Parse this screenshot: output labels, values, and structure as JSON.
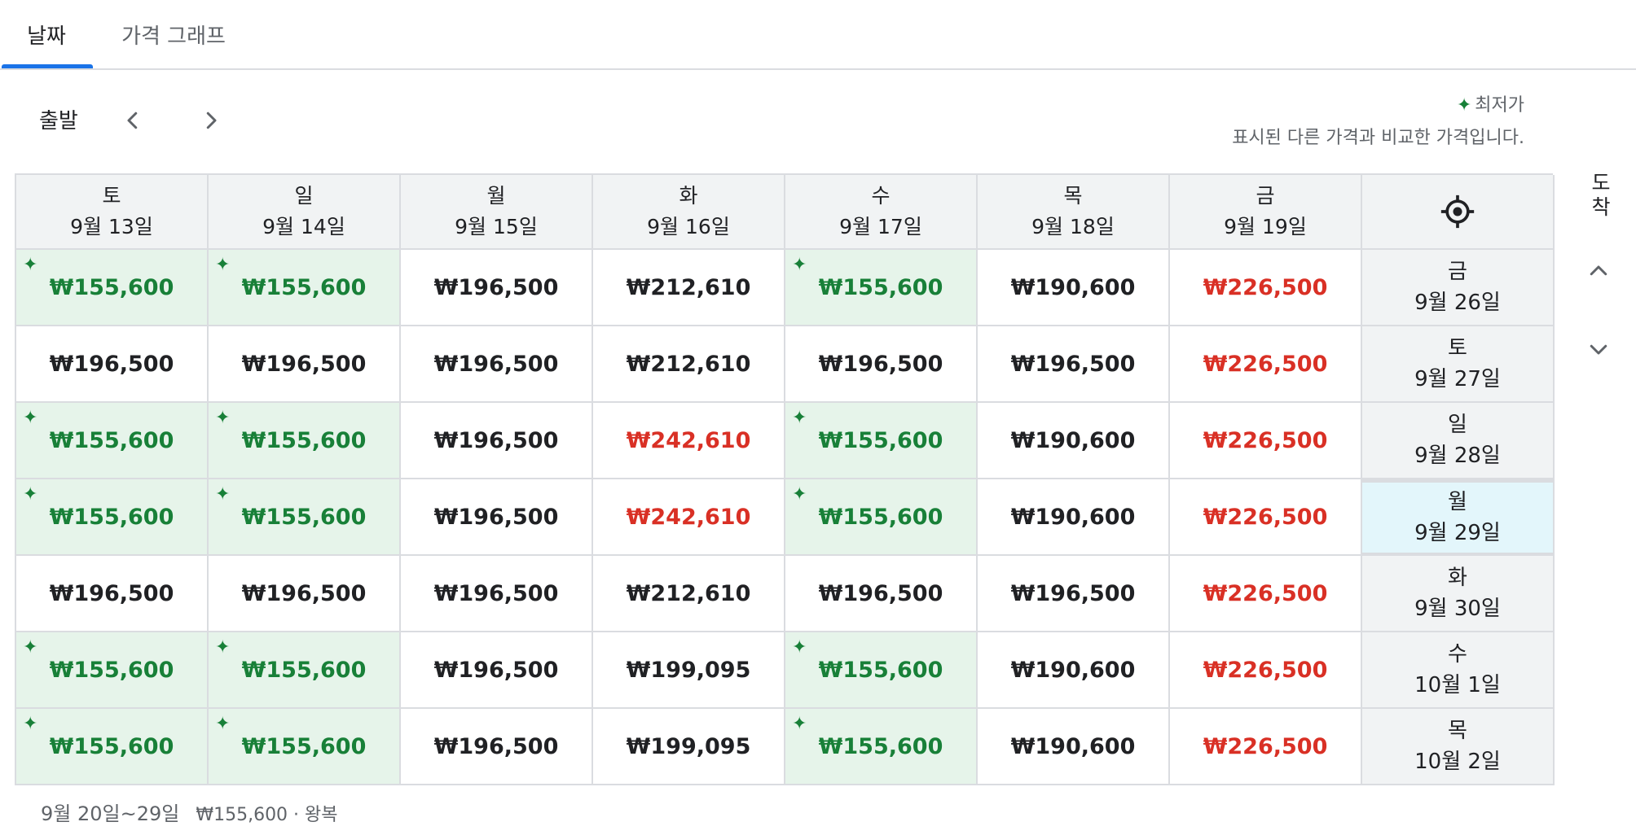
{
  "tabs": [
    {
      "label": "날짜",
      "active": true
    },
    {
      "label": "가격 그래프",
      "active": false
    }
  ],
  "toolbar": {
    "departure_label": "출발",
    "arrival_label": "도착"
  },
  "legend": {
    "title": "최저가",
    "description": "표시된 다른 가격과 비교한 가격입니다."
  },
  "colors": {
    "low": "#188038",
    "low_bg": "#e6f4ea",
    "high": "#d93025",
    "accent": "#1a73e8"
  },
  "departure_dates": [
    {
      "weekday": "토",
      "date": "9월 13일"
    },
    {
      "weekday": "일",
      "date": "9월 14일"
    },
    {
      "weekday": "월",
      "date": "9월 15일"
    },
    {
      "weekday": "화",
      "date": "9월 16일"
    },
    {
      "weekday": "수",
      "date": "9월 17일"
    },
    {
      "weekday": "목",
      "date": "9월 18일"
    },
    {
      "weekday": "금",
      "date": "9월 19일"
    }
  ],
  "return_dates": [
    {
      "weekday": "금",
      "date": "9월 26일"
    },
    {
      "weekday": "토",
      "date": "9월 27일"
    },
    {
      "weekday": "일",
      "date": "9월 28일"
    },
    {
      "weekday": "월",
      "date": "9월 29일",
      "selected": true
    },
    {
      "weekday": "화",
      "date": "9월 30일"
    },
    {
      "weekday": "수",
      "date": "10월 1일"
    },
    {
      "weekday": "목",
      "date": "10월 2일"
    }
  ],
  "rows": [
    [
      {
        "v": "₩155,600",
        "k": "low"
      },
      {
        "v": "₩155,600",
        "k": "low"
      },
      {
        "v": "₩196,500",
        "k": ""
      },
      {
        "v": "₩212,610",
        "k": ""
      },
      {
        "v": "₩155,600",
        "k": "low"
      },
      {
        "v": "₩190,600",
        "k": ""
      },
      {
        "v": "₩226,500",
        "k": "high"
      }
    ],
    [
      {
        "v": "₩196,500",
        "k": ""
      },
      {
        "v": "₩196,500",
        "k": ""
      },
      {
        "v": "₩196,500",
        "k": ""
      },
      {
        "v": "₩212,610",
        "k": ""
      },
      {
        "v": "₩196,500",
        "k": ""
      },
      {
        "v": "₩196,500",
        "k": ""
      },
      {
        "v": "₩226,500",
        "k": "high"
      }
    ],
    [
      {
        "v": "₩155,600",
        "k": "low"
      },
      {
        "v": "₩155,600",
        "k": "low"
      },
      {
        "v": "₩196,500",
        "k": ""
      },
      {
        "v": "₩242,610",
        "k": "high"
      },
      {
        "v": "₩155,600",
        "k": "low"
      },
      {
        "v": "₩190,600",
        "k": ""
      },
      {
        "v": "₩226,500",
        "k": "high"
      }
    ],
    [
      {
        "v": "₩155,600",
        "k": "low"
      },
      {
        "v": "₩155,600",
        "k": "low"
      },
      {
        "v": "₩196,500",
        "k": ""
      },
      {
        "v": "₩242,610",
        "k": "high"
      },
      {
        "v": "₩155,600",
        "k": "low"
      },
      {
        "v": "₩190,600",
        "k": ""
      },
      {
        "v": "₩226,500",
        "k": "high"
      }
    ],
    [
      {
        "v": "₩196,500",
        "k": ""
      },
      {
        "v": "₩196,500",
        "k": ""
      },
      {
        "v": "₩196,500",
        "k": ""
      },
      {
        "v": "₩212,610",
        "k": ""
      },
      {
        "v": "₩196,500",
        "k": ""
      },
      {
        "v": "₩196,500",
        "k": ""
      },
      {
        "v": "₩226,500",
        "k": "high"
      }
    ],
    [
      {
        "v": "₩155,600",
        "k": "low"
      },
      {
        "v": "₩155,600",
        "k": "low"
      },
      {
        "v": "₩196,500",
        "k": ""
      },
      {
        "v": "₩199,095",
        "k": ""
      },
      {
        "v": "₩155,600",
        "k": "low"
      },
      {
        "v": "₩190,600",
        "k": ""
      },
      {
        "v": "₩226,500",
        "k": "high"
      }
    ],
    [
      {
        "v": "₩155,600",
        "k": "low"
      },
      {
        "v": "₩155,600",
        "k": "low"
      },
      {
        "v": "₩196,500",
        "k": ""
      },
      {
        "v": "₩199,095",
        "k": ""
      },
      {
        "v": "₩155,600",
        "k": "low"
      },
      {
        "v": "₩190,600",
        "k": ""
      },
      {
        "v": "₩226,500",
        "k": "high"
      }
    ]
  ],
  "footer": {
    "dates": "9월 20일~29일",
    "price": "₩155,600 · 왕복"
  }
}
